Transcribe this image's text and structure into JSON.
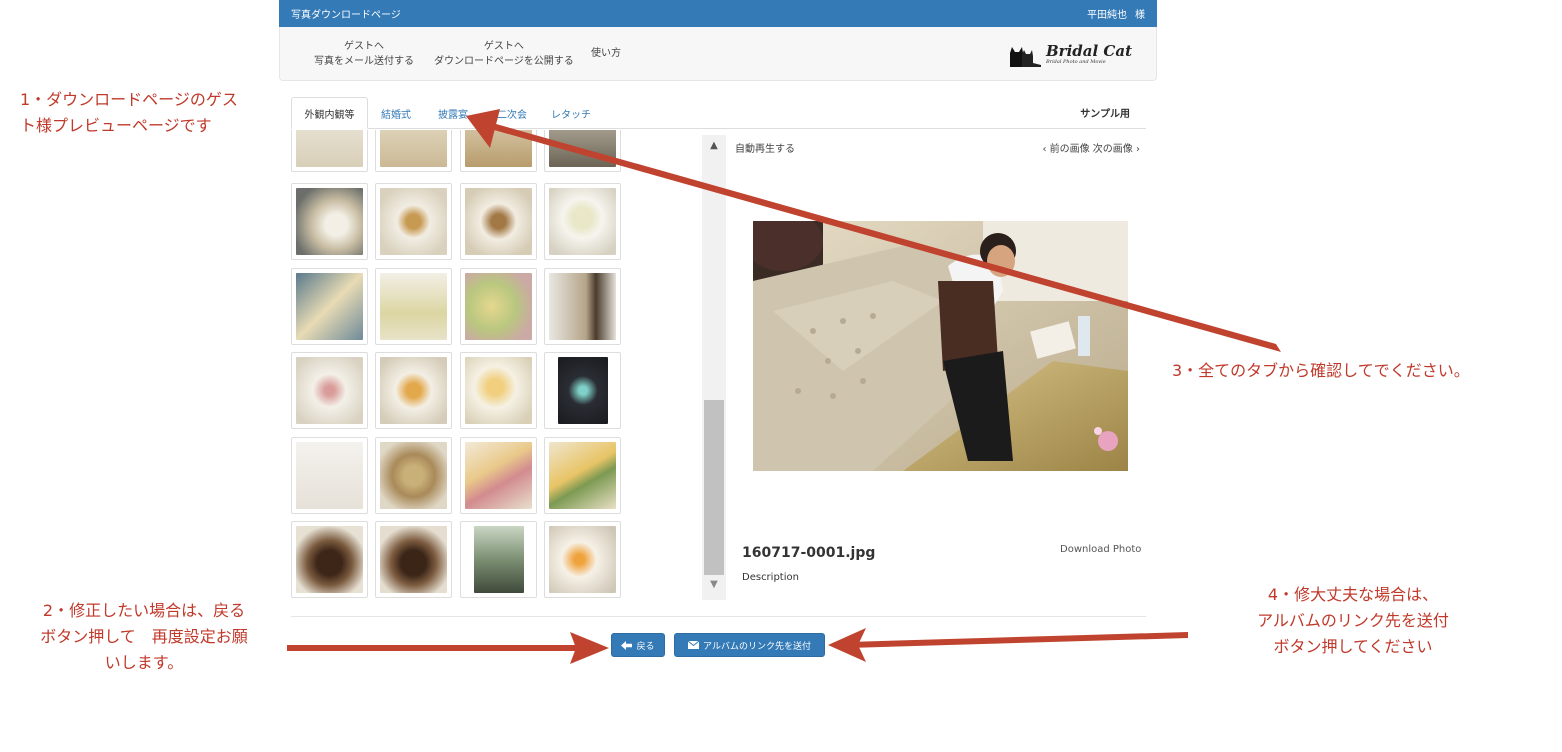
{
  "topbar": {
    "title": "写真ダウンロードページ",
    "user_name": "平田純也",
    "user_suffix": "様"
  },
  "nav": {
    "items": [
      {
        "line1": "ゲストへ",
        "line2": "写真をメール送付する"
      },
      {
        "line1": "ゲストへ",
        "line2": "ダウンロードページを公開する"
      },
      {
        "line1": "使い方",
        "line2": ""
      }
    ],
    "logo_title": "Bridal Cat",
    "logo_subtitle": "Bridal Photo and Movie"
  },
  "tabs": [
    "外観内観等",
    "結婚式",
    "披露宴",
    "二次会",
    "レタッチ"
  ],
  "active_tab": 0,
  "tab_right_label": "サンプル用",
  "viewer": {
    "autoplay": "自動再生する",
    "prev_next": "‹ 前の画像  次の画像 ›",
    "filename": "160717-0001.jpg",
    "download": "Download Photo",
    "description": "Description"
  },
  "scroll": {
    "up_arrow": "▲",
    "down_arrow": "▼"
  },
  "buttons": {
    "back": "戻る",
    "send": "アルバムのリンク先を送付"
  },
  "annotations": {
    "note1": [
      "1・ダウンロードページのゲス",
      "ト様プレビューページです"
    ],
    "note2": [
      "2・修正したい場合は、戻る",
      "ボタン押して　再度設定お願",
      "いします。"
    ],
    "note3": [
      "3・全てのタブから確認してでください。"
    ],
    "note4": [
      "4・修大丈夫な場合は、",
      "アルバムのリンク先を送付",
      "ボタン押してください"
    ]
  },
  "colors": {
    "header": "#337ab7",
    "button": "#337ab7",
    "annotation": "#c0392b",
    "arrow": "#c0432f"
  }
}
